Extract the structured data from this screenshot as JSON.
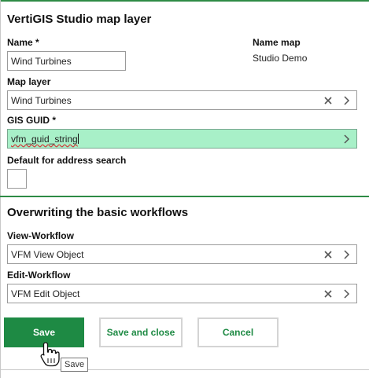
{
  "panel": {
    "title": "VertiGIS Studio map layer"
  },
  "fields": {
    "name": {
      "label": "Name *",
      "value": "Wind Turbines"
    },
    "name_map": {
      "label": "Name map",
      "value": "Studio Demo"
    },
    "map_layer": {
      "label": "Map layer",
      "value": "Wind Turbines"
    },
    "gis_guid": {
      "label": "GIS GUID *",
      "value": "vfm_guid_string"
    },
    "default_address_search": {
      "label": "Default for address search",
      "checked": false
    }
  },
  "workflows": {
    "title": "Overwriting the basic workflows",
    "view": {
      "label": "View-Workflow",
      "value": "VFM View Object"
    },
    "edit": {
      "label": "Edit-Workflow",
      "value": "VFM Edit Object"
    }
  },
  "actions": {
    "save_label": "Save",
    "save_close_label": "Save and close",
    "cancel_label": "Cancel"
  },
  "tooltip": {
    "text": "Save"
  },
  "icons": {
    "clear": "close-icon",
    "open": "chevron-right-icon"
  },
  "colors": {
    "accent": "#1e8a44",
    "highlight": "#a8f0c8"
  }
}
